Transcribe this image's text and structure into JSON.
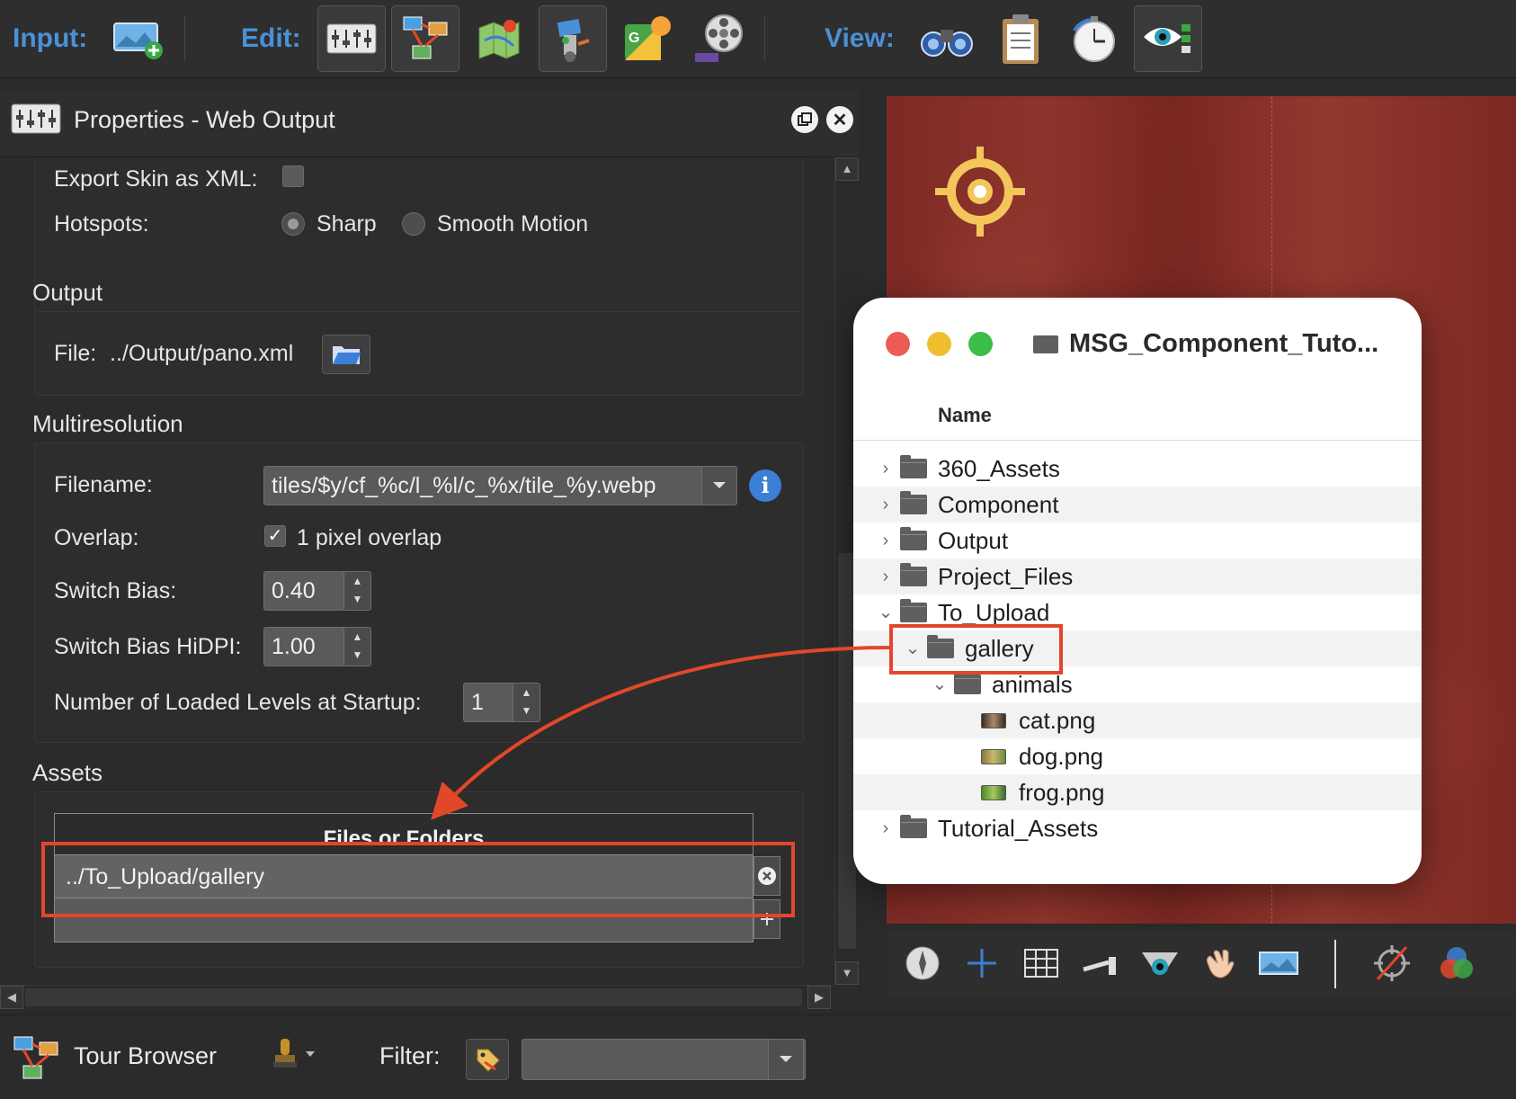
{
  "toolbar": {
    "input_label": "Input:",
    "edit_label": "Edit:",
    "view_label": "View:",
    "input_tools": [
      "add-panorama-icon"
    ],
    "edit_tools": [
      "properties-sliders-icon",
      "tour-browser-icon",
      "floor-plan-icon",
      "skin-editor-icon",
      "google-maps-icon",
      "animation-film-icon"
    ],
    "view_tools": [
      "binoculars-icon",
      "clipboard-icon",
      "stopwatch-icon",
      "eye-check-icon"
    ]
  },
  "properties": {
    "title": "Properties - Web Output",
    "export_skin_label": "Export Skin as XML:",
    "export_skin_checked": false,
    "hotspots_label": "Hotspots:",
    "hotspots_options": [
      "Sharp",
      "Smooth Motion"
    ],
    "hotspots_selected": "Sharp",
    "output_section": "Output",
    "file_label": "File:",
    "file_value": "../Output/pano.xml",
    "multires_section": "Multiresolution",
    "filename_label": "Filename:",
    "filename_value": "tiles/$y/cf_%c/l_%l/c_%x/tile_%y.webp",
    "overlap_label": "Overlap:",
    "overlap_checked": true,
    "overlap_text": "1 pixel overlap",
    "switch_bias_label": "Switch Bias:",
    "switch_bias_value": "0.40",
    "switch_bias_hidpi_label": "Switch Bias HiDPI:",
    "switch_bias_hidpi_value": "1.00",
    "loaded_levels_label": "Number of Loaded Levels at Startup:",
    "loaded_levels_value": "1",
    "assets_section": "Assets",
    "assets_header": "Files or Folders",
    "assets_rows": [
      "../To_Upload/gallery"
    ]
  },
  "bottom": {
    "tour_browser_label": "Tour Browser",
    "filter_label": "Filter:",
    "filter_value": ""
  },
  "viewer_tools": [
    "compass-icon",
    "crosshair-plus-icon",
    "grid-icon",
    "ruler-icon",
    "viewpoint-eye-icon",
    "hand-icon",
    "panorama-icon",
    "hotspot-off-icon",
    "color-circles-icon"
  ],
  "finder": {
    "title": "MSG_Component_Tuto...",
    "column_name": "Name",
    "rows": [
      {
        "name": "360_Assets",
        "kind": "folder",
        "expanded": false,
        "depth": 0
      },
      {
        "name": "Component",
        "kind": "folder",
        "expanded": false,
        "depth": 0
      },
      {
        "name": "Output",
        "kind": "folder",
        "expanded": false,
        "depth": 0
      },
      {
        "name": "Project_Files",
        "kind": "folder",
        "expanded": false,
        "depth": 0
      },
      {
        "name": "To_Upload",
        "kind": "folder",
        "expanded": true,
        "depth": 0
      },
      {
        "name": "gallery",
        "kind": "folder",
        "expanded": true,
        "depth": 1
      },
      {
        "name": "animals",
        "kind": "folder",
        "expanded": true,
        "depth": 2
      },
      {
        "name": "cat.png",
        "kind": "image",
        "depth": 3
      },
      {
        "name": "dog.png",
        "kind": "image",
        "depth": 3
      },
      {
        "name": "frog.png",
        "kind": "image",
        "depth": 3
      },
      {
        "name": "Tutorial_Assets",
        "kind": "folder",
        "expanded": false,
        "depth": 0
      }
    ]
  },
  "colors": {
    "accent_blue": "#4a90d9",
    "highlight_red": "#e2472a",
    "panel_bg": "#2b2b2b",
    "viewer_red": "#8d342c"
  }
}
